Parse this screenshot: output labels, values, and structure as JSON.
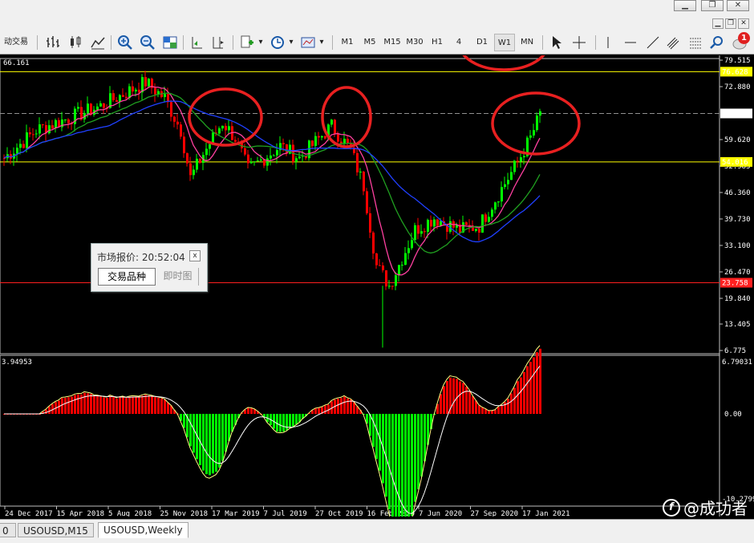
{
  "toolbar": {
    "autotrade_label": "动交易",
    "timeframes": [
      "M1",
      "M5",
      "M15",
      "M30",
      "H1",
      "4",
      "D1",
      "W1",
      "MN"
    ],
    "active_timeframe": "W1",
    "notification_count": "1"
  },
  "chart": {
    "symbol_price_top": "66.161",
    "price_scale": [
      "79.515",
      "72.880",
      "59.620",
      "52.985",
      "46.360",
      "39.730",
      "33.100",
      "26.470",
      "19.840",
      "13.405",
      "6.775"
    ],
    "level_labels": {
      "yellow_top": "76.628",
      "current": "66.161",
      "yellow_mid": "54.016",
      "red": "23.758"
    },
    "level_colors": {
      "yellow": "#ffff00",
      "current": "#c0c0c0",
      "red": "#ff2020",
      "current_box": "#ffffff",
      "red_box": "#ff2020"
    },
    "time_labels": [
      "24 Dec 2017",
      "15 Apr 2018",
      "5 Aug 2018",
      "25 Nov 2018",
      "17 Mar 2019",
      "7 Jul 2019",
      "27 Oct 2019",
      "16 Feb 2020",
      "7 Jun 2020",
      "27 Sep 2020",
      "17 Jan 2021"
    ],
    "ma_colors": {
      "pink": "#ff40a0",
      "green": "#20a020",
      "blue": "#2040ff"
    },
    "candle_colors": {
      "up": "#00ff00",
      "down": "#ff0000"
    }
  },
  "indicator": {
    "left_value": "3.94953",
    "scale": [
      "6.79031",
      "0.00",
      "-10.2799"
    ],
    "hist_colors": {
      "pos": "#ff0000",
      "neg": "#00ff00"
    }
  },
  "popup": {
    "title": "市场报价: 20:52:04",
    "close_label": "x",
    "tab_symbols": "交易品种",
    "tab_tick": "即时图"
  },
  "tabs": [
    "0",
    "USOUSD,M15",
    "USOUSD,Weekly"
  ],
  "active_tab": "USOUSD,Weekly",
  "watermark": "@成功者",
  "annotation_color": "#e82020"
}
